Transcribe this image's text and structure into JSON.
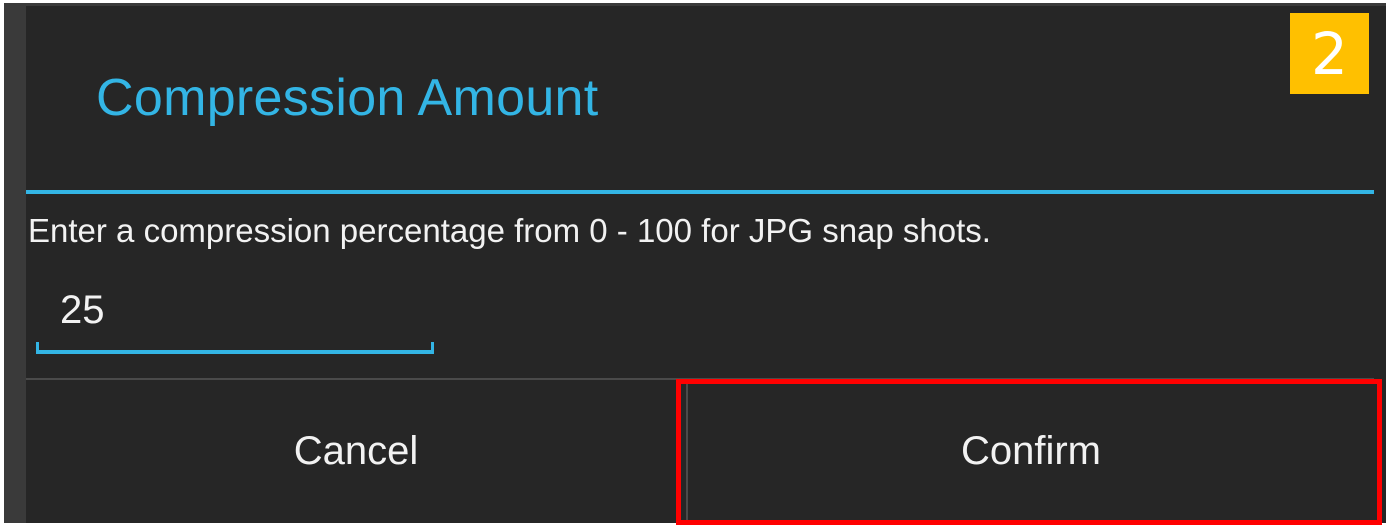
{
  "dialog": {
    "title": "Compression Amount",
    "message": "Enter a compression percentage from 0 - 100 for JPG snap shots.",
    "input_value": "25",
    "cancel_label": "Cancel",
    "confirm_label": "Confirm"
  },
  "annotation": {
    "step_number": "2",
    "highlight_color": "#ff0000",
    "badge_color": "#ffc000"
  },
  "colors": {
    "accent": "#33b5e5",
    "dialog_background": "#262626",
    "text": "#f2f2f2"
  }
}
